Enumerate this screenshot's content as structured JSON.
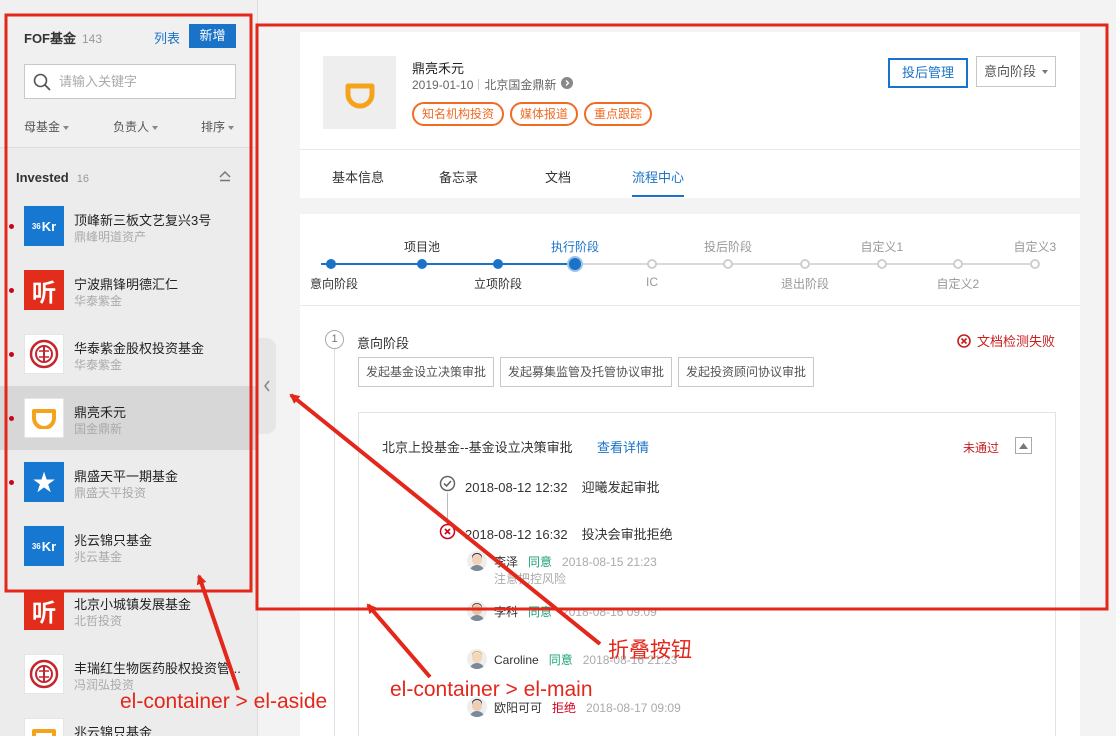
{
  "aside": {
    "title": "FOF基金",
    "count": "143",
    "list_label": "列表",
    "add_label": "新增",
    "search_placeholder": "请输入关键字",
    "filters": [
      "母基金",
      "负责人",
      "排序"
    ],
    "group": {
      "title": "Invested",
      "count": "16"
    },
    "funds": [
      {
        "name": "顶峰新三板文艺复兴3号",
        "sub": "鼎峰明道资产",
        "logo": "36kr-logo",
        "dot": true
      },
      {
        "name": "宁波鼎锋明德汇仁",
        "sub": "华泰紫金",
        "logo": "ting-logo",
        "dot": true
      },
      {
        "name": "华泰紫金股权投资基金",
        "sub": "华泰紫金",
        "logo": "seal-logo",
        "dot": true
      },
      {
        "name": "鼎亮禾元",
        "sub": "国金鼎新",
        "logo": "didi-logo",
        "dot": true,
        "active": true
      },
      {
        "name": "鼎盛天平一期基金",
        "sub": "鼎盛天平投资",
        "logo": "star-logo",
        "dot": true
      },
      {
        "name": "兆云锦只基金",
        "sub": "兆云基金",
        "logo": "36kr-logo",
        "dot": false
      },
      {
        "name": "北京小城镇发展基金",
        "sub": "北哲投资",
        "logo": "ting-logo",
        "dot": false
      },
      {
        "name": "丰瑞红生物医药股权投资管...",
        "sub": "冯润弘投资",
        "logo": "seal-logo",
        "dot": false
      },
      {
        "name": "兆云锦只基金",
        "sub": "",
        "logo": "didi-logo",
        "dot": false
      }
    ]
  },
  "project": {
    "name": "鼎亮禾元",
    "date": "2019-01-10",
    "org": "北京国金鼎新",
    "tags": [
      "知名机构投资",
      "媒体报道",
      "重点跟踪"
    ],
    "post_invest_button": "投后管理",
    "stage_select_value": "意向阶段"
  },
  "tabs": [
    "基本信息",
    "备忘录",
    "文档",
    "流程中心"
  ],
  "active_tab": "流程中心",
  "stages": [
    {
      "label": "意向阶段",
      "state": "done"
    },
    {
      "label": "项目池",
      "state": "done"
    },
    {
      "label": "立项阶段",
      "state": "done"
    },
    {
      "label": "执行阶段",
      "state": "current"
    },
    {
      "label": "IC",
      "state": "todo"
    },
    {
      "label": "投后阶段",
      "state": "todo"
    },
    {
      "label": "退出阶段",
      "state": "todo"
    },
    {
      "label": "自定义1",
      "state": "todo"
    },
    {
      "label": "自定义2",
      "state": "todo"
    },
    {
      "label": "自定义3",
      "state": "todo"
    }
  ],
  "step": {
    "number": "1",
    "title": "意向阶段",
    "doc_check_status": "文档检测失败",
    "approval_buttons": [
      "发起基金设立决策审批",
      "发起募集监管及托管协议审批",
      "发起投资顾问协议审批"
    ]
  },
  "record": {
    "title": "北京上投基金--基金设立决策审批",
    "view_details": "查看详情",
    "status": "未通过",
    "timeline": [
      {
        "time": "2018-08-12 12:32",
        "action": "迎曦发起审批",
        "icon": "check-circle-icon"
      },
      {
        "time": "2018-08-12 16:32",
        "action": "投决会审批拒绝",
        "icon": "reject-circle-icon"
      }
    ],
    "reviews": [
      {
        "name": "李泽",
        "result": "同意",
        "time": "2018-08-15 21:23",
        "note": "注意把控风险"
      },
      {
        "name": "李科",
        "result": "同意",
        "time": "2018-08-16 09:09",
        "note": ""
      },
      {
        "name": "Caroline",
        "result": "同意",
        "time": "2018-08-16 21:23",
        "note": ""
      },
      {
        "name": "欧阳可可",
        "result": "拒绝",
        "time": "2018-08-17 09:09",
        "note": ""
      }
    ]
  },
  "annotations": {
    "aside_label": "el-container > el-aside",
    "main_label": "el-container > el-main",
    "collapse_label": "折叠按钮",
    "color": "#e3271b"
  },
  "colors": {
    "primary": "#1a73c7",
    "tag": "#f06b23",
    "danger": "#c81e1e",
    "agree": "#1aa17a"
  }
}
